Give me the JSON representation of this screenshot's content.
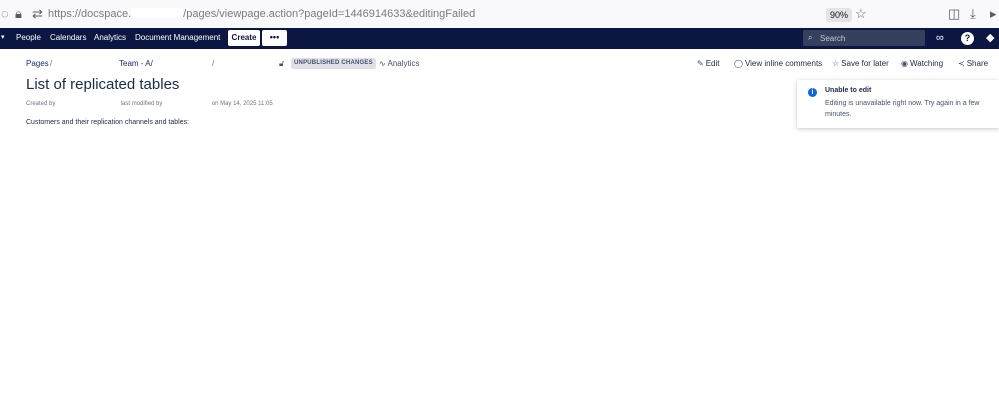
{
  "browser": {
    "url_prefix": "https://docspace.",
    "url_path": "/pages/viewpage.action?pageId=1446914633&editingFailed",
    "zoom": "90%"
  },
  "nav": {
    "items": [
      "People",
      "Calendars",
      "Analytics",
      "Document Management"
    ],
    "create_label": "Create",
    "more_label": "•••",
    "search_placeholder": "Search"
  },
  "page": {
    "breadcrumb_root": "Pages",
    "breadcrumb_sep": "/",
    "breadcrumb_space": "Team - A/",
    "unpublished_badge": "UNPUBLISHED CHANGES",
    "analytics_label": "Analytics",
    "actions": {
      "edit": "Edit",
      "comments": "View inline comments",
      "save": "Save for later",
      "watching": "Watching",
      "share": "Share"
    },
    "title": "List of replicated tables",
    "created_by": "Created by",
    "last_modified": "last modified by",
    "modified_date": "on May 14, 2025 11:05",
    "body_text": "Customers and their replication channels and tables:"
  },
  "flag": {
    "title": "Unable to edit",
    "body": "Editing is unavailable right now. Try again in a few minutes."
  },
  "colors": {
    "nav_bg": "#0b1742",
    "link": "#1c2b72",
    "info": "#0c66e4"
  }
}
